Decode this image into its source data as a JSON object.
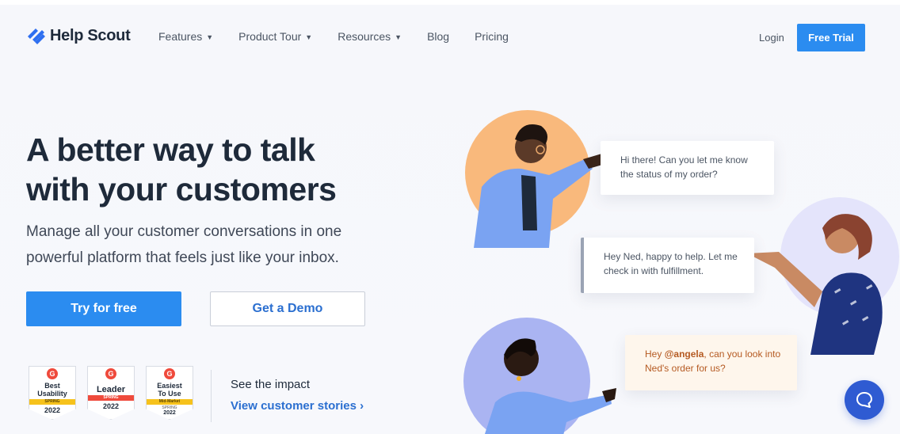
{
  "brand": {
    "logo_text": "Help Scout",
    "accent": "#2b8cf0",
    "logo_color": "#2e6ff0"
  },
  "nav": {
    "items": [
      {
        "label": "Features",
        "has_dropdown": true
      },
      {
        "label": "Product Tour",
        "has_dropdown": true
      },
      {
        "label": "Resources",
        "has_dropdown": true
      },
      {
        "label": "Blog",
        "has_dropdown": false
      },
      {
        "label": "Pricing",
        "has_dropdown": false
      }
    ],
    "login": "Login",
    "cta": "Free Trial"
  },
  "hero": {
    "title_line1": "A better way to talk",
    "title_line2": "with your customers",
    "subtitle_line1": "Manage all your customer conversations in one",
    "subtitle_line2": "powerful platform that feels just like your inbox.",
    "primary_button": "Try for free",
    "secondary_button": "Get a Demo"
  },
  "badges": [
    {
      "title_line1": "Best",
      "title_line2": "Usability",
      "band": "SPRING",
      "year": "2022"
    },
    {
      "title_line1": "Leader",
      "title_line2": "",
      "band": "SPRING",
      "year": "2022"
    },
    {
      "title_line1": "Easiest",
      "title_line2": "To Use",
      "band": "Mid-Market",
      "sub": "SPRING",
      "year": "2022"
    }
  ],
  "impact": {
    "title": "See the impact",
    "link": "View customer stories ›"
  },
  "chat": {
    "bubble1": "Hi there! Can you let me know the status of my order?",
    "bubble2": "Hey Ned, happy to help. Let me check in with fulfillment.",
    "bubble3_prefix": "Hey ",
    "bubble3_mention": "@angela",
    "bubble3_suffix": ", can you look into Ned's order for us?"
  },
  "icons": {
    "logo": "help-scout-logo-icon",
    "chat": "chat-bubble-icon",
    "chevron": "chevron-down-icon"
  }
}
